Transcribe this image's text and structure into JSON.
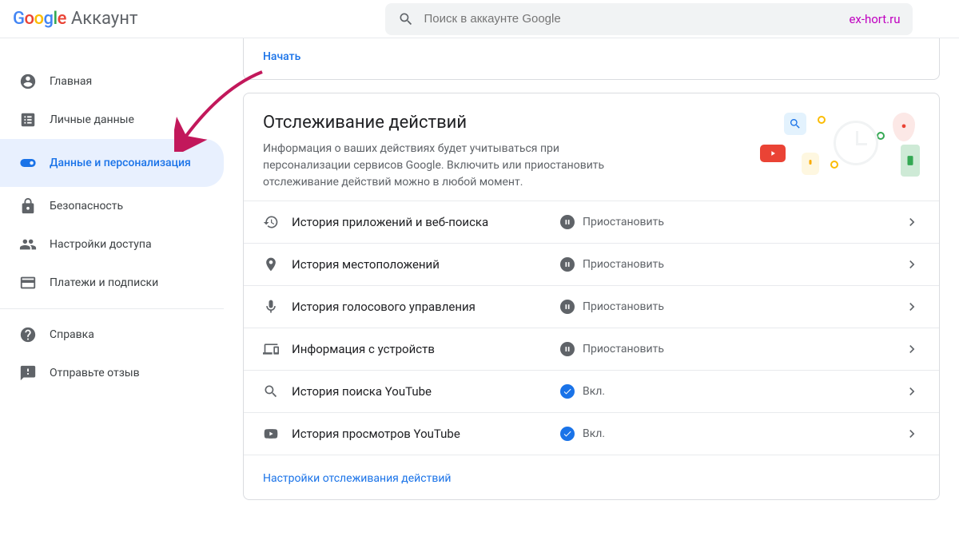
{
  "header": {
    "logo_text": "Google",
    "account_label": "Аккаунт",
    "search_placeholder": "Поиск в аккаунте Google",
    "search_highlight": "ex-hort.ru"
  },
  "sidebar": {
    "items": [
      {
        "label": "Главная"
      },
      {
        "label": "Личные данные"
      },
      {
        "label": "Данные и персонализация"
      },
      {
        "label": "Безопасность"
      },
      {
        "label": "Настройки доступа"
      },
      {
        "label": "Платежи и подписки"
      }
    ],
    "help": [
      {
        "label": "Справка"
      },
      {
        "label": "Отправьте отзыв"
      }
    ]
  },
  "top_card": {
    "start": "Начать"
  },
  "activity_card": {
    "title": "Отслеживание действий",
    "description": "Информация о ваших действиях будет учитываться при персонализации сервисов Google. Включить или приостановить отслеживание действий можно в любой момент.",
    "rows": [
      {
        "label": "История приложений и веб-поиска",
        "status": "Приостановить",
        "state": "paused"
      },
      {
        "label": "История местоположений",
        "status": "Приостановить",
        "state": "paused"
      },
      {
        "label": "История голосового управления",
        "status": "Приостановить",
        "state": "paused"
      },
      {
        "label": "Информация с устройств",
        "status": "Приостановить",
        "state": "paused"
      },
      {
        "label": "История поиска YouTube",
        "status": "Вкл.",
        "state": "on"
      },
      {
        "label": "История просмотров YouTube",
        "status": "Вкл.",
        "state": "on"
      }
    ],
    "footer_link": "Настройки отслеживания действий"
  },
  "colors": {
    "accent": "#1a73e8",
    "highlight": "#c000c0"
  }
}
